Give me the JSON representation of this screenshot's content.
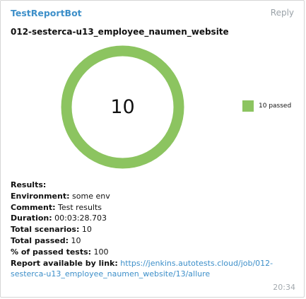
{
  "message": {
    "sender": "TestReportBot",
    "reply_label": "Reply",
    "title": "012-sesterca-u13_employee_naumen_website",
    "time": "20:34"
  },
  "chart_data": {
    "type": "pie",
    "center_label": "10",
    "slices": [
      {
        "label": "10 passed",
        "value": 10,
        "color": "#8cc460"
      }
    ],
    "legend_position": "right"
  },
  "results": {
    "heading": "Results:",
    "environment_label": "Environment:",
    "environment_value": " some env",
    "comment_label": "Comment:",
    "comment_value": " Test results",
    "duration_label": "Duration:",
    "duration_value": " 00:03:28.703",
    "total_scenarios_label": "Total scenarios:",
    "total_scenarios_value": " 10",
    "total_passed_label": "Total passed:",
    "total_passed_value": " 10",
    "percent_label": "% of passed tests:",
    "percent_value": " 100",
    "report_label": "Report available by link:",
    "report_link": "https://jenkins.autotests.cloud/job/012-sesterca-u13_employee_naumen_website/13/allure"
  }
}
